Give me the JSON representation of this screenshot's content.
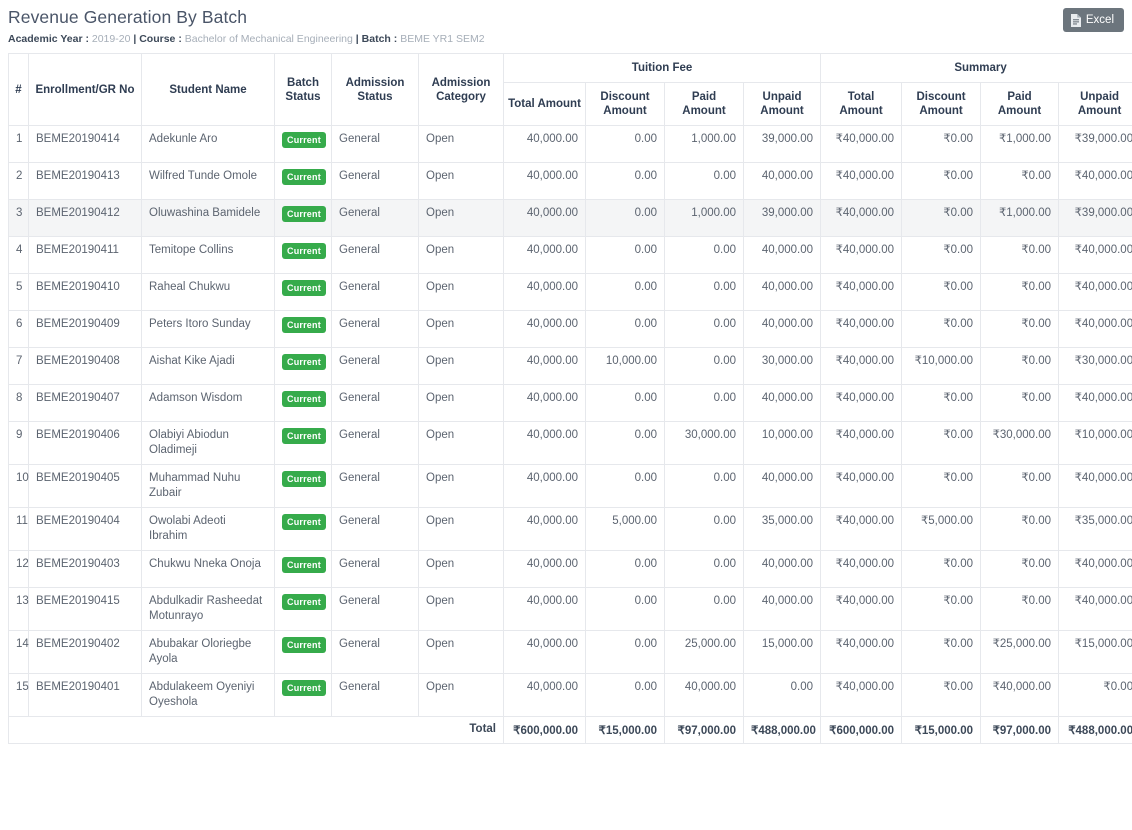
{
  "header": {
    "title": "Revenue Generation By Batch",
    "meta": {
      "academic_year_label": "Academic Year",
      "academic_year_value": "2019-20",
      "course_label": "Course",
      "course_value": "Bachelor of Mechanical Engineering",
      "batch_label": "Batch",
      "batch_value": "BEME YR1 SEM2",
      "separator": "|",
      "colon": ":"
    },
    "export_button": {
      "label": "Excel",
      "icon": "excel-document-icon",
      "background_color": "#6c757d"
    }
  },
  "table": {
    "group_headers": {
      "tuition_fee": "Tuition Fee",
      "summary": "Summary"
    },
    "columns": [
      "#",
      "Enrollment/GR No",
      "Student Name",
      "Batch Status",
      "Admission Status",
      "Admission Category"
    ],
    "amount_columns": [
      "Total Amount",
      "Discount Amount",
      "Paid Amount",
      "Unpaid Amount"
    ],
    "badge_color": "#36ab4b",
    "hover_row_index": 3,
    "rows": [
      {
        "idx": "1",
        "enrollment": "BEME20190414",
        "name": "Adekunle Aro",
        "batch_status": "Current",
        "admission_status": "General",
        "admission_category": "Open",
        "fee_total": "40,000.00",
        "fee_discount": "0.00",
        "fee_paid": "1,000.00",
        "fee_unpaid": "39,000.00",
        "sum_total": "₹40,000.00",
        "sum_discount": "₹0.00",
        "sum_paid": "₹1,000.00",
        "sum_unpaid": "₹39,000.00"
      },
      {
        "idx": "2",
        "enrollment": "BEME20190413",
        "name": "Wilfred Tunde Omole",
        "batch_status": "Current",
        "admission_status": "General",
        "admission_category": "Open",
        "fee_total": "40,000.00",
        "fee_discount": "0.00",
        "fee_paid": "0.00",
        "fee_unpaid": "40,000.00",
        "sum_total": "₹40,000.00",
        "sum_discount": "₹0.00",
        "sum_paid": "₹0.00",
        "sum_unpaid": "₹40,000.00"
      },
      {
        "idx": "3",
        "enrollment": "BEME20190412",
        "name": "Oluwashina Bamidele",
        "batch_status": "Current",
        "admission_status": "General",
        "admission_category": "Open",
        "fee_total": "40,000.00",
        "fee_discount": "0.00",
        "fee_paid": "1,000.00",
        "fee_unpaid": "39,000.00",
        "sum_total": "₹40,000.00",
        "sum_discount": "₹0.00",
        "sum_paid": "₹1,000.00",
        "sum_unpaid": "₹39,000.00"
      },
      {
        "idx": "4",
        "enrollment": "BEME20190411",
        "name": "Temitope Collins",
        "batch_status": "Current",
        "admission_status": "General",
        "admission_category": "Open",
        "fee_total": "40,000.00",
        "fee_discount": "0.00",
        "fee_paid": "0.00",
        "fee_unpaid": "40,000.00",
        "sum_total": "₹40,000.00",
        "sum_discount": "₹0.00",
        "sum_paid": "₹0.00",
        "sum_unpaid": "₹40,000.00"
      },
      {
        "idx": "5",
        "enrollment": "BEME20190410",
        "name": "Raheal Chukwu",
        "batch_status": "Current",
        "admission_status": "General",
        "admission_category": "Open",
        "fee_total": "40,000.00",
        "fee_discount": "0.00",
        "fee_paid": "0.00",
        "fee_unpaid": "40,000.00",
        "sum_total": "₹40,000.00",
        "sum_discount": "₹0.00",
        "sum_paid": "₹0.00",
        "sum_unpaid": "₹40,000.00"
      },
      {
        "idx": "6",
        "enrollment": "BEME20190409",
        "name": "Peters Itoro Sunday",
        "batch_status": "Current",
        "admission_status": "General",
        "admission_category": "Open",
        "fee_total": "40,000.00",
        "fee_discount": "0.00",
        "fee_paid": "0.00",
        "fee_unpaid": "40,000.00",
        "sum_total": "₹40,000.00",
        "sum_discount": "₹0.00",
        "sum_paid": "₹0.00",
        "sum_unpaid": "₹40,000.00"
      },
      {
        "idx": "7",
        "enrollment": "BEME20190408",
        "name": "Aishat Kike Ajadi",
        "batch_status": "Current",
        "admission_status": "General",
        "admission_category": "Open",
        "fee_total": "40,000.00",
        "fee_discount": "10,000.00",
        "fee_paid": "0.00",
        "fee_unpaid": "30,000.00",
        "sum_total": "₹40,000.00",
        "sum_discount": "₹10,000.00",
        "sum_paid": "₹0.00",
        "sum_unpaid": "₹30,000.00"
      },
      {
        "idx": "8",
        "enrollment": "BEME20190407",
        "name": "Adamson Wisdom",
        "batch_status": "Current",
        "admission_status": "General",
        "admission_category": "Open",
        "fee_total": "40,000.00",
        "fee_discount": "0.00",
        "fee_paid": "0.00",
        "fee_unpaid": "40,000.00",
        "sum_total": "₹40,000.00",
        "sum_discount": "₹0.00",
        "sum_paid": "₹0.00",
        "sum_unpaid": "₹40,000.00"
      },
      {
        "idx": "9",
        "enrollment": "BEME20190406",
        "name": "Olabiyi Abiodun Oladimeji",
        "batch_status": "Current",
        "admission_status": "General",
        "admission_category": "Open",
        "fee_total": "40,000.00",
        "fee_discount": "0.00",
        "fee_paid": "30,000.00",
        "fee_unpaid": "10,000.00",
        "sum_total": "₹40,000.00",
        "sum_discount": "₹0.00",
        "sum_paid": "₹30,000.00",
        "sum_unpaid": "₹10,000.00"
      },
      {
        "idx": "10",
        "enrollment": "BEME20190405",
        "name": "Muhammad Nuhu Zubair",
        "batch_status": "Current",
        "admission_status": "General",
        "admission_category": "Open",
        "fee_total": "40,000.00",
        "fee_discount": "0.00",
        "fee_paid": "0.00",
        "fee_unpaid": "40,000.00",
        "sum_total": "₹40,000.00",
        "sum_discount": "₹0.00",
        "sum_paid": "₹0.00",
        "sum_unpaid": "₹40,000.00"
      },
      {
        "idx": "11",
        "enrollment": "BEME20190404",
        "name": "Owolabi Adeoti Ibrahim",
        "batch_status": "Current",
        "admission_status": "General",
        "admission_category": "Open",
        "fee_total": "40,000.00",
        "fee_discount": "5,000.00",
        "fee_paid": "0.00",
        "fee_unpaid": "35,000.00",
        "sum_total": "₹40,000.00",
        "sum_discount": "₹5,000.00",
        "sum_paid": "₹0.00",
        "sum_unpaid": "₹35,000.00"
      },
      {
        "idx": "12",
        "enrollment": "BEME20190403",
        "name": "Chukwu Nneka Onoja",
        "batch_status": "Current",
        "admission_status": "General",
        "admission_category": "Open",
        "fee_total": "40,000.00",
        "fee_discount": "0.00",
        "fee_paid": "0.00",
        "fee_unpaid": "40,000.00",
        "sum_total": "₹40,000.00",
        "sum_discount": "₹0.00",
        "sum_paid": "₹0.00",
        "sum_unpaid": "₹40,000.00"
      },
      {
        "idx": "13",
        "enrollment": "BEME20190415",
        "name": "Abdulkadir Rasheedat Motunrayo",
        "batch_status": "Current",
        "admission_status": "General",
        "admission_category": "Open",
        "fee_total": "40,000.00",
        "fee_discount": "0.00",
        "fee_paid": "0.00",
        "fee_unpaid": "40,000.00",
        "sum_total": "₹40,000.00",
        "sum_discount": "₹0.00",
        "sum_paid": "₹0.00",
        "sum_unpaid": "₹40,000.00"
      },
      {
        "idx": "14",
        "enrollment": "BEME20190402",
        "name": "Abubakar Oloriegbe Ayola",
        "batch_status": "Current",
        "admission_status": "General",
        "admission_category": "Open",
        "fee_total": "40,000.00",
        "fee_discount": "0.00",
        "fee_paid": "25,000.00",
        "fee_unpaid": "15,000.00",
        "sum_total": "₹40,000.00",
        "sum_discount": "₹0.00",
        "sum_paid": "₹25,000.00",
        "sum_unpaid": "₹15,000.00"
      },
      {
        "idx": "15",
        "enrollment": "BEME20190401",
        "name": "Abdulakeem Oyeniyi Oyeshola",
        "batch_status": "Current",
        "admission_status": "General",
        "admission_category": "Open",
        "fee_total": "40,000.00",
        "fee_discount": "0.00",
        "fee_paid": "40,000.00",
        "fee_unpaid": "0.00",
        "sum_total": "₹40,000.00",
        "sum_discount": "₹0.00",
        "sum_paid": "₹40,000.00",
        "sum_unpaid": "₹0.00"
      }
    ],
    "footer": {
      "label": "Total",
      "fee_total": "₹600,000.00",
      "fee_discount": "₹15,000.00",
      "fee_paid": "₹97,000.00",
      "fee_unpaid": "₹488,000.00",
      "sum_total": "₹600,000.00",
      "sum_discount": "₹15,000.00",
      "sum_paid": "₹97,000.00",
      "sum_unpaid": "₹488,000.00"
    }
  }
}
